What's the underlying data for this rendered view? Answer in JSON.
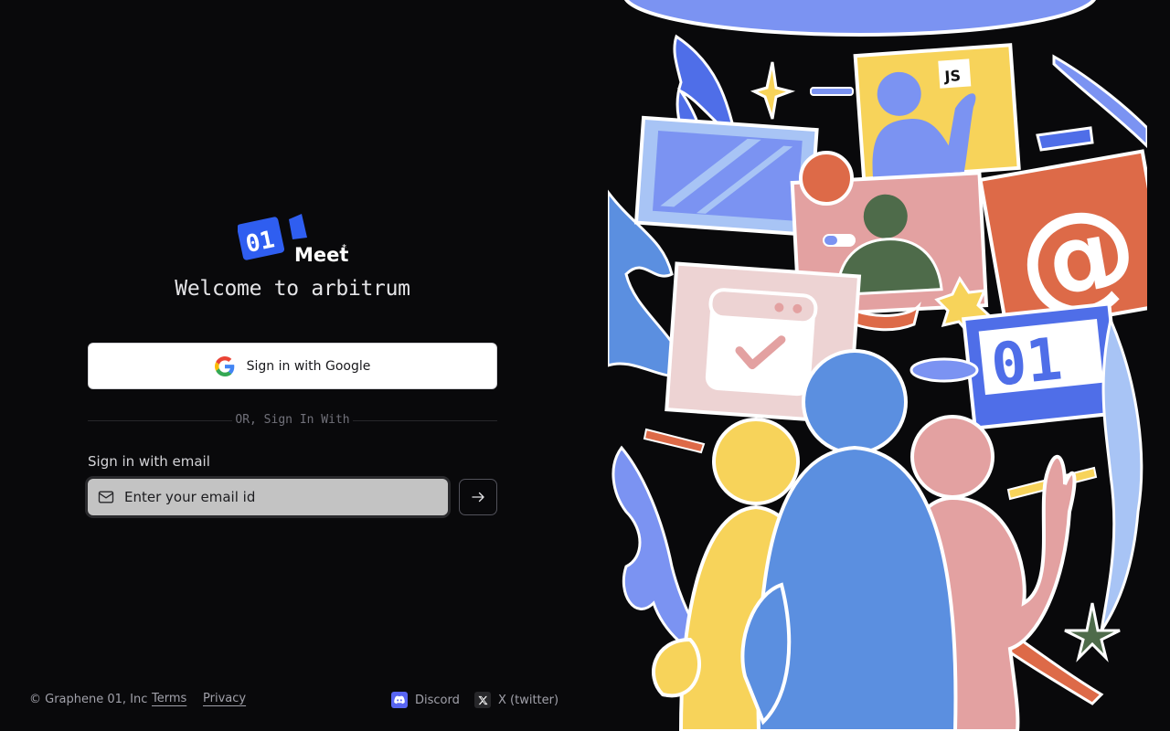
{
  "brand": {
    "logo_text": "01",
    "logo_sub": "Meet",
    "welcome": "Welcome to arbitrum"
  },
  "auth": {
    "google_label": "Sign in with Google",
    "divider_text": "OR, Sign In With",
    "email_label": "Sign in with email",
    "email_placeholder": "Enter your email id",
    "email_value": ""
  },
  "footer": {
    "copyright": "© Graphene 01, Inc",
    "terms": "Terms",
    "privacy": "Privacy",
    "discord": "Discord",
    "x": "X (twitter)"
  },
  "illustration": {
    "js_badge": "JS",
    "at_symbol": "@",
    "board_text": "01"
  },
  "icons": {
    "google": "google-icon",
    "mail": "mail-icon",
    "arrow": "arrow-right-icon",
    "discord": "discord-icon",
    "x": "x-icon"
  },
  "colors": {
    "background": "#09090b",
    "brand_blue": "#2f5ef0",
    "discord": "#5865f2"
  }
}
